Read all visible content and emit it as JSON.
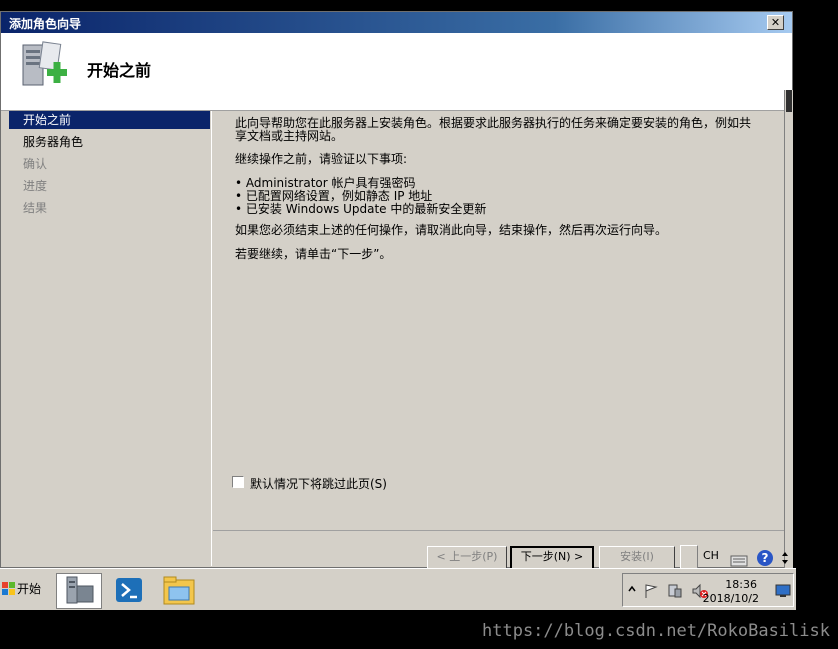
{
  "window": {
    "title": "添加角色向导",
    "close_glyph": "✕",
    "header_title": "开始之前"
  },
  "nav": {
    "items": [
      {
        "label": "开始之前",
        "state": "active"
      },
      {
        "label": "服务器角色",
        "state": "normal"
      },
      {
        "label": "确认",
        "state": "dim"
      },
      {
        "label": "进度",
        "state": "dim"
      },
      {
        "label": "结果",
        "state": "dim"
      }
    ]
  },
  "content": {
    "intro": "此向导帮助您在此服务器上安装角色。根据要求此服务器执行的任务来确定要安装的角色，例如共享文档或主持网站。",
    "verify": "继续操作之前，请验证以下事项:",
    "bullets": [
      "• Administrator 帐户具有强密码",
      "• 已配置网络设置，例如静态 IP 地址",
      "• 已安装 Windows Update 中的最新安全更新"
    ],
    "cancel_note": "如果您必须结束上述的任何操作，请取消此向导，结束操作，然后再次运行向导。",
    "continue_note": "若要继续，请单击“下一步”。",
    "skip_label": "默认情况下将跳过此页(S)",
    "skip_checked": false
  },
  "buttons": {
    "back": "< 上一步(P)",
    "next": "下一步(N) >",
    "install": "安装(I)"
  },
  "langbar": {
    "language": "CH",
    "keyboard_icon": "keyboard-icon",
    "help_icon": "help-icon"
  },
  "taskbar": {
    "start_label": "开始",
    "apps": [
      "server-manager-icon",
      "powershell-icon",
      "explorer-icon"
    ],
    "clock_time": "18:36",
    "clock_date": "2018/10/2",
    "tray_icons": [
      "chevron-up-icon",
      "flag-icon",
      "network-icon",
      "volume-muted-icon",
      "desktop-icon"
    ]
  },
  "colors": {
    "title_gradient_start": "#0a246a",
    "face": "#d4d0c8",
    "nav_active": "#0a246a"
  },
  "watermark": "https://blog.csdn.net/RokoBasilisk"
}
